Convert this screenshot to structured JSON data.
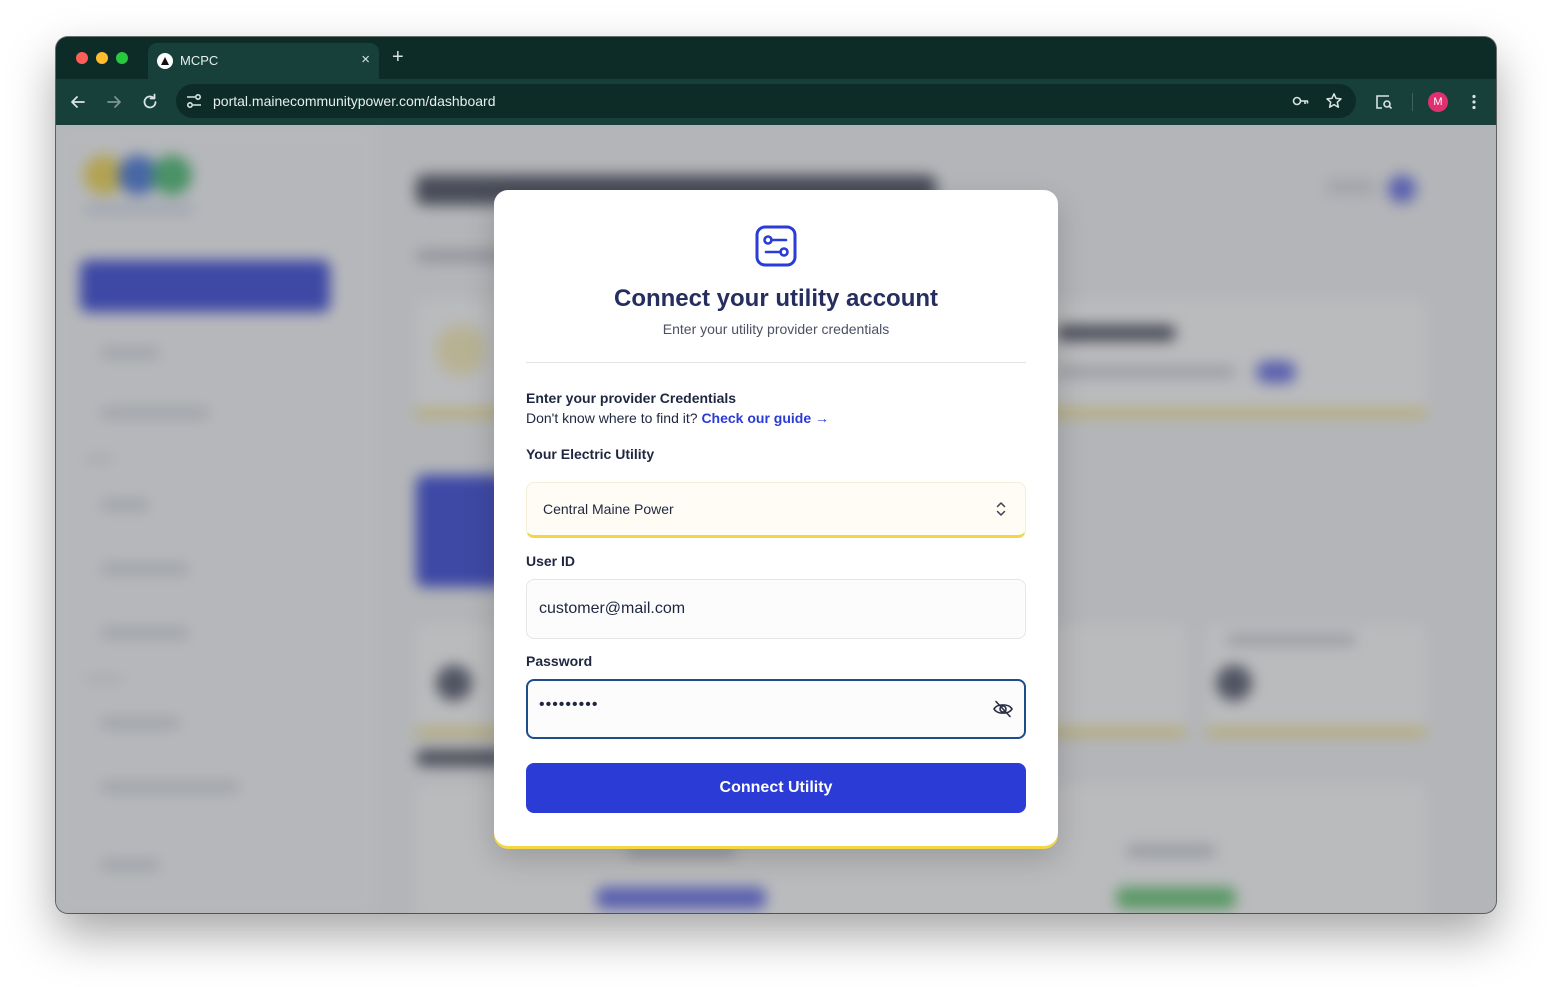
{
  "browser": {
    "tab_title": "MCPC",
    "tab_close": "×",
    "new_tab": "+",
    "url": "portal.mainecommunitypower.com/dashboard",
    "profile_initial": "M"
  },
  "modal": {
    "icon": "sliders-icon",
    "title": "Connect your utility account",
    "subtitle": "Enter your utility provider credentials",
    "credentials_heading": "Enter your provider Credentials",
    "help_text": "Don't know where to find it? ",
    "help_link": "Check our guide",
    "help_arrow": "→",
    "utility_label": "Your Electric Utility",
    "utility_value": "Central Maine Power",
    "userid_label": "User ID",
    "userid_value": "customer@mail.com",
    "password_label": "Password",
    "password_masked": "•••••••••",
    "submit_label": "Connect Utility"
  },
  "colors": {
    "primary": "#2a3bd6",
    "title": "#262e60",
    "accent_yellow": "#f2d646",
    "browser_chrome": "#0d2b27"
  }
}
